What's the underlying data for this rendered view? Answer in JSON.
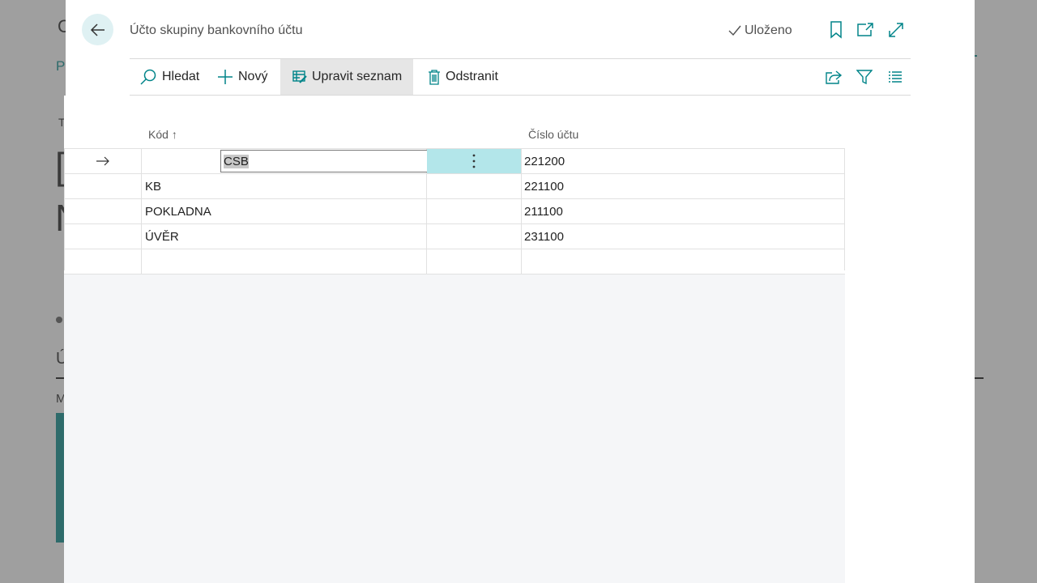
{
  "background_page": {
    "letters": [
      "C",
      "P",
      "T",
      "[",
      "N",
      "Ú",
      "M"
    ]
  },
  "dialog": {
    "title": "Účto skupiny bankovního účtu",
    "status": "Uloženo",
    "icons": {
      "back": "arrow-left-icon",
      "bookmark": "bookmark-icon",
      "open_new": "open-in-new-window-icon",
      "expand": "expand-icon"
    }
  },
  "toolbar": {
    "search_label": "Hledat",
    "new_label": "Nový",
    "edit_list_label": "Upravit seznam",
    "delete_label": "Odstranit",
    "icons": [
      "share-icon",
      "filter-icon",
      "list-view-icon"
    ]
  },
  "grid": {
    "columns": {
      "code": "Kód",
      "code_sort_indicator": "↑",
      "account": "Číslo účtu"
    },
    "rows": [
      {
        "code": "CSB",
        "account": "221200",
        "current": true
      },
      {
        "code": "KB",
        "account": "221100",
        "current": false
      },
      {
        "code": "POKLADNA",
        "account": "211100",
        "current": false
      },
      {
        "code": "ÚVĚR",
        "account": "231100",
        "current": false
      },
      {
        "code": "",
        "account": "",
        "current": false
      }
    ]
  },
  "colors": {
    "accent": "#008489",
    "selection_cell": "#b3e6ea",
    "back_button_bg": "#dff1f3"
  }
}
